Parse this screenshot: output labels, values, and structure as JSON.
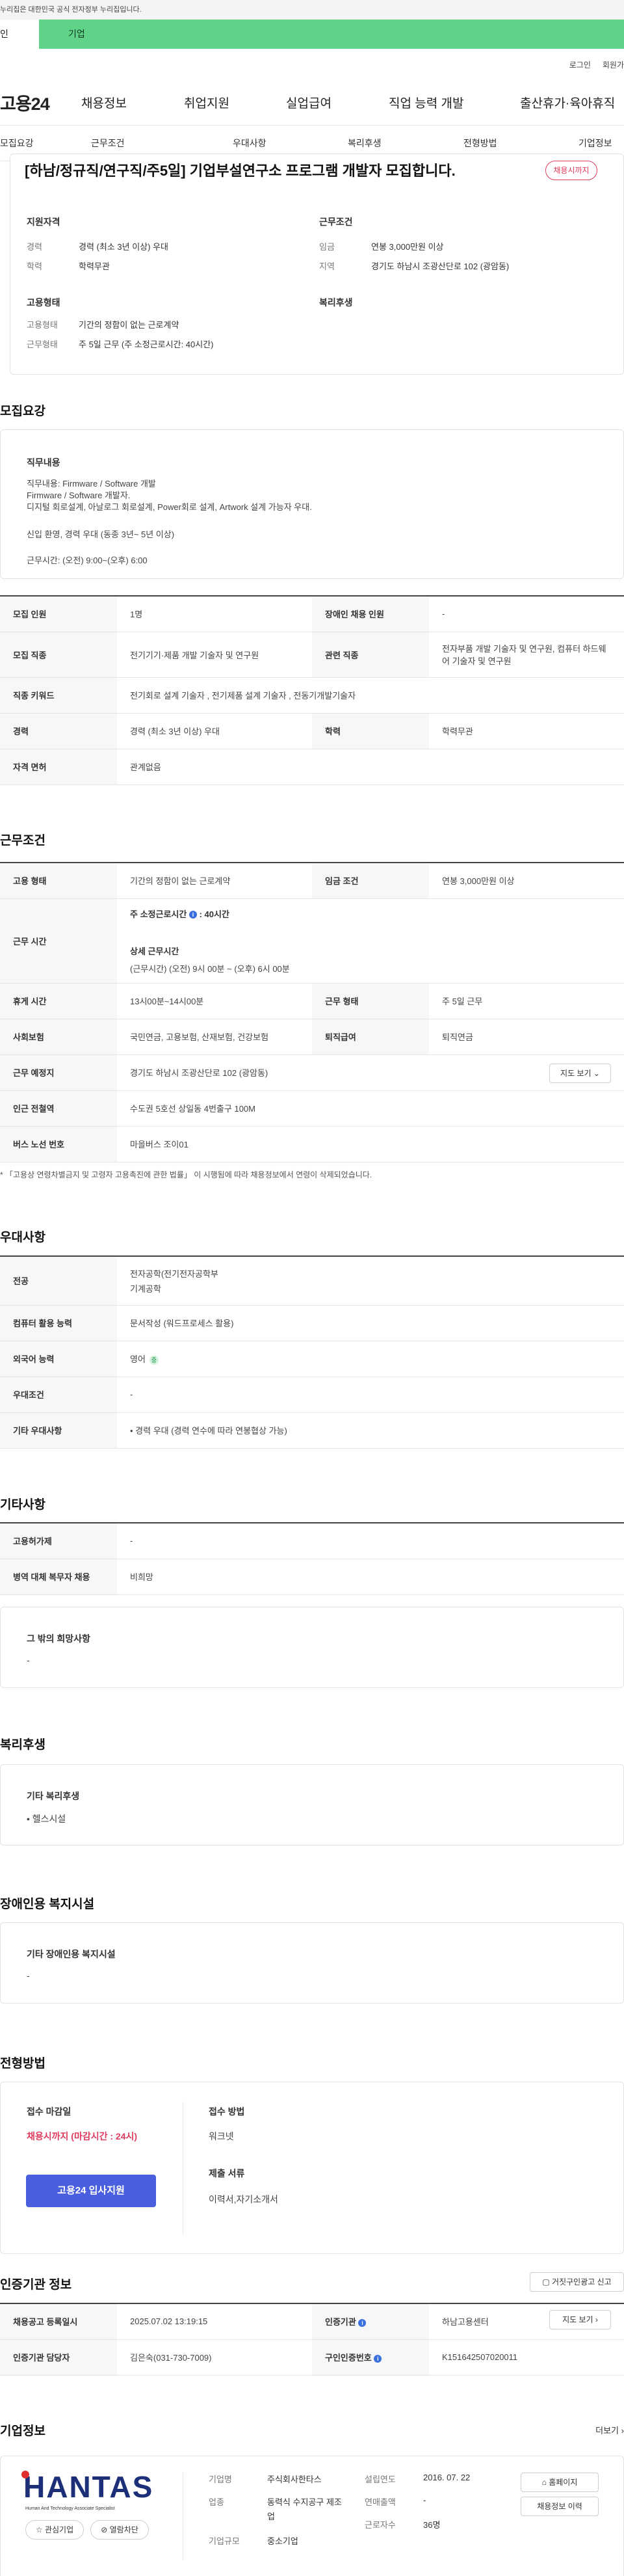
{
  "gov_banner": "누리집은 대한민국 공식 전자정부 누리집입니다.",
  "tabs": {
    "personal": "인",
    "company": "기업"
  },
  "util": {
    "login": "로그인",
    "signup": "회원가"
  },
  "gnb": {
    "logo": "고용24",
    "menu": [
      "채용정보",
      "취업지원",
      "실업급여",
      "직업 능력 개발",
      "출산휴가·육아휴직"
    ]
  },
  "anchor_nav": [
    "모집요강",
    "근무조건",
    "우대사항",
    "복리후생",
    "전형방법",
    "기업정보"
  ],
  "summary": {
    "title": "[하남/정규직/연구직/주5일] 기업부설연구소 프로그램 개발자 모집합니다.",
    "deadline_badge": "채용시까지",
    "qual_head": "지원자격",
    "career_label": "경력",
    "career_value": "경력 (최소 3년 이상) 우대",
    "edu_label": "학력",
    "edu_value": "학력무관",
    "cond_head": "근무조건",
    "wage_label": "임금",
    "wage_value": "연봉 3,000만원 이상",
    "region_label": "지역",
    "region_value": "경기도 하남시 조광산단로 102 (광암동)",
    "emp_head": "고용형태",
    "emp_label": "고용형태",
    "emp_value": "기간의 정함이 없는 근로계약",
    "hours_label": "근무형태",
    "hours_value": "주 5일 근무 (주 소정근로시간: 40시간)",
    "welfare_head": "복리후생"
  },
  "recruit": {
    "title": "모집요강",
    "duty_head": "직무내용",
    "duty_lines": [
      "직무내용:  Firmware / Software 개발",
      "Firmware / Software 개발자.",
      "디지털 회로설계, 아날로그 회로설계, Power회로 설계, Artwork 설계 가능자 우대.",
      "신입 환영,  경력 우대 (동종 3년~ 5년 이상)",
      "근무시간: (오전) 9:00~(오후) 6:00"
    ],
    "rows": {
      "headcount_label": "모집 인원",
      "headcount_value": "1명",
      "disabled_label": "장애인 채용 인원",
      "disabled_value": "-",
      "job_label": "모집 직종",
      "job_value": "전기기기·제품 개발 기술자 및 연구원",
      "related_label": "관련 직종",
      "related_value": "전자부품 개발 기술자 및 연구원, 컴퓨터 하드웨어 기술자 및 연구원",
      "keyword_label": "직종 키워드",
      "keyword_value": "전기회로 설계 기술자 , 전기제품 설계 기술자 , 전동기개발기술자",
      "career_label": "경력",
      "career_value": "경력 (최소 3년 이상) 우대",
      "edu_label": "학력",
      "edu_value": "학력무관",
      "license_label": "자격 면허",
      "license_value": "관계없음"
    }
  },
  "work": {
    "title": "근무조건",
    "emp_label": "고용 형태",
    "emp_value": "기간의 정함이 없는 근로계약",
    "wage_label": "임금 조건",
    "wage_value": "연봉 3,000만원 이상",
    "time_label": "근무 시간",
    "time_weekly": "주 소정근로시간",
    "time_weekly_info": "i",
    "time_weekly_value": ": 40시간",
    "time_detail_head": "상세 근무시간",
    "time_detail_value": "(근무시간) (오전) 9시 00분 ~ (오후) 6시 00분",
    "rest_label": "휴게 시간",
    "rest_value": "13시00분~14시00분",
    "form_label": "근무 형태",
    "form_value": "주 5일 근무",
    "insurance_label": "사회보험",
    "insurance_value": "국민연금, 고용보험, 산재보험, 건강보험",
    "severance_label": "퇴직급여",
    "severance_value": "퇴직연금",
    "place_label": "근무 예정지",
    "place_value": "경기도 하남시 조광산단로 102 (광암동)",
    "map_button": "지도 보기",
    "subway_label": "인근 전철역",
    "subway_value": "수도권 5호선 상일동 4번출구 100M",
    "bus_label": "버스 노선 번호",
    "bus_value": "마을버스 조이01",
    "footnote": "* 「고용상 연령차별금지 및 고령자 고용촉진에 관한 법률」 이 시행됨에 따라 채용정보에서 연령이 삭제되었습니다."
  },
  "preference": {
    "title": "우대사항",
    "major_label": "전공",
    "major_values": [
      "전자공학(전기전자공학부",
      "기계공학"
    ],
    "computer_label": "컴퓨터 활용 능력",
    "computer_value": "문서작성 (워드프로세스 활용)",
    "lang_label": "외국어 능력",
    "lang_value": "영어",
    "lang_badge": "중",
    "cond_label": "우대조건",
    "cond_value": "-",
    "other_label": "기타 우대사항",
    "other_value": "• 경력 우대 (경력 연수에 따라 연봉협상 가능)"
  },
  "etc": {
    "title": "기타사항",
    "policy_label": "고용허가제",
    "policy_value": "-",
    "military_label": "병역 대체 복무자 채용",
    "military_value": "비희망",
    "wish_head": "그 밖의 희망사항",
    "wish_value": "-"
  },
  "welfare": {
    "title": "복리후생",
    "head": "기타 복리후생",
    "value": "• 헬스시설"
  },
  "disabled_fac": {
    "title": "장애인용 복지시설",
    "head": "기타 장애인용 복지시설",
    "value": "-"
  },
  "selection": {
    "title": "전형방법",
    "deadline_head": "접수 마감일",
    "deadline_value": "채용시까지 (마감시간 : 24시)",
    "apply_button": "고용24 입사지원",
    "method_head": "접수 방법",
    "method_value": "워크넷",
    "docs_head": "제출 서류",
    "docs_value": "이력서,자기소개서"
  },
  "agency": {
    "title": "인증기관 정보",
    "report_button": "거짓구인광고 신고",
    "reg_label": "채용공고 등록일시",
    "reg_value": "2025.07.02 13:19:15",
    "org_label": "인증기관",
    "org_value": "하남고용센터",
    "map_button": "지도 보기",
    "manager_label": "인증기관 담당자",
    "manager_value": "김은숙(031-730-7009)",
    "cert_label": "구인인증번호",
    "cert_value": "K151642507020011",
    "info_icon": "i"
  },
  "company": {
    "title": "기업정보",
    "more": "더보기",
    "logo_text": "HANTAS",
    "logo_tagline": "Human And Technology Associate Specialist",
    "fav_button": "관심기업",
    "block_button": "열람차단",
    "name_label": "기업명",
    "name_value": "주식회사한타스",
    "found_label": "설립연도",
    "found_value": "2016. 07. 22",
    "industry_label": "업종",
    "industry_value": "동력식 수지공구 제조업",
    "sales_label": "연매출액",
    "sales_value": "-",
    "size_label": "기업규모",
    "size_value": "중소기업",
    "staff_label": "근로자수",
    "staff_value": "36명",
    "homepage_button": "홈페이지",
    "history_button": "채용정보 이력"
  },
  "colors": {
    "accent_green": "#60d388",
    "primary_blue": "#4a5fe0",
    "deadline_red": "#e03c5d"
  }
}
